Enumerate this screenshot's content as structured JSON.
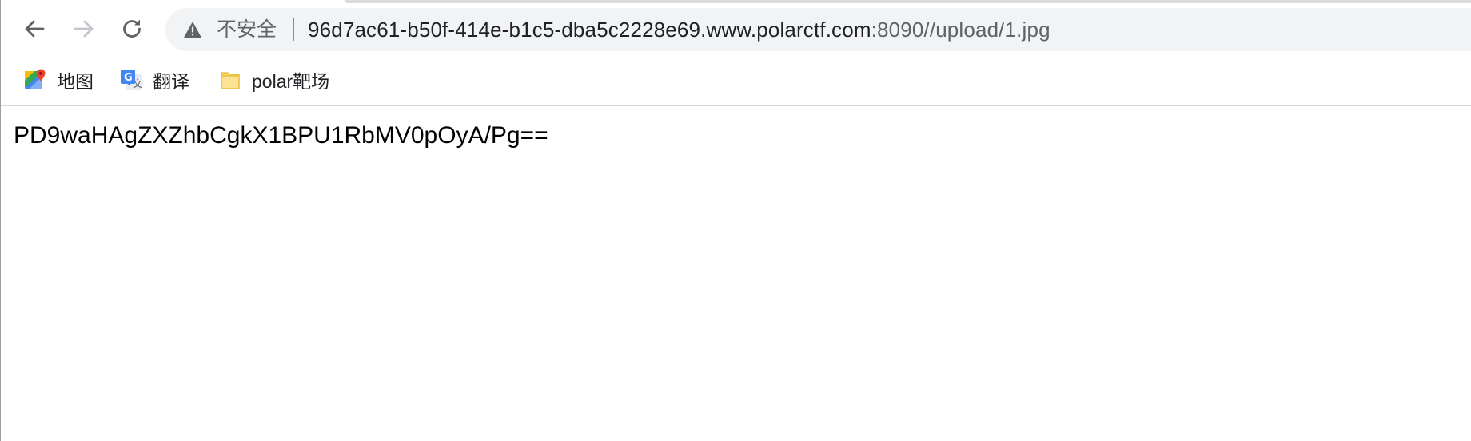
{
  "toolbar": {
    "security_label": "不安全",
    "url_host": "96d7ac61-b50f-414e-b1c5-dba5c2228e69.www.polarctf.com",
    "url_rest": ":8090//upload/1.jpg",
    "back_icon": "arrow-left-icon",
    "forward_icon": "arrow-right-icon",
    "reload_icon": "reload-icon",
    "security_icon": "warning-triangle-icon"
  },
  "bookmarks": [
    {
      "label": "地图",
      "icon": "google-maps-icon"
    },
    {
      "label": "翻译",
      "icon": "google-translate-icon"
    },
    {
      "label": "polar靶场",
      "icon": "folder-icon"
    }
  ],
  "page": {
    "content": "PD9waHAgZXZhbCgkX1BPU1RbMV0pOyA/Pg=="
  },
  "colors": {
    "omnibox_bg": "#f1f3f4",
    "text_primary": "#202124",
    "text_secondary": "#5f6368",
    "icon_disabled": "#c3c6ca"
  }
}
